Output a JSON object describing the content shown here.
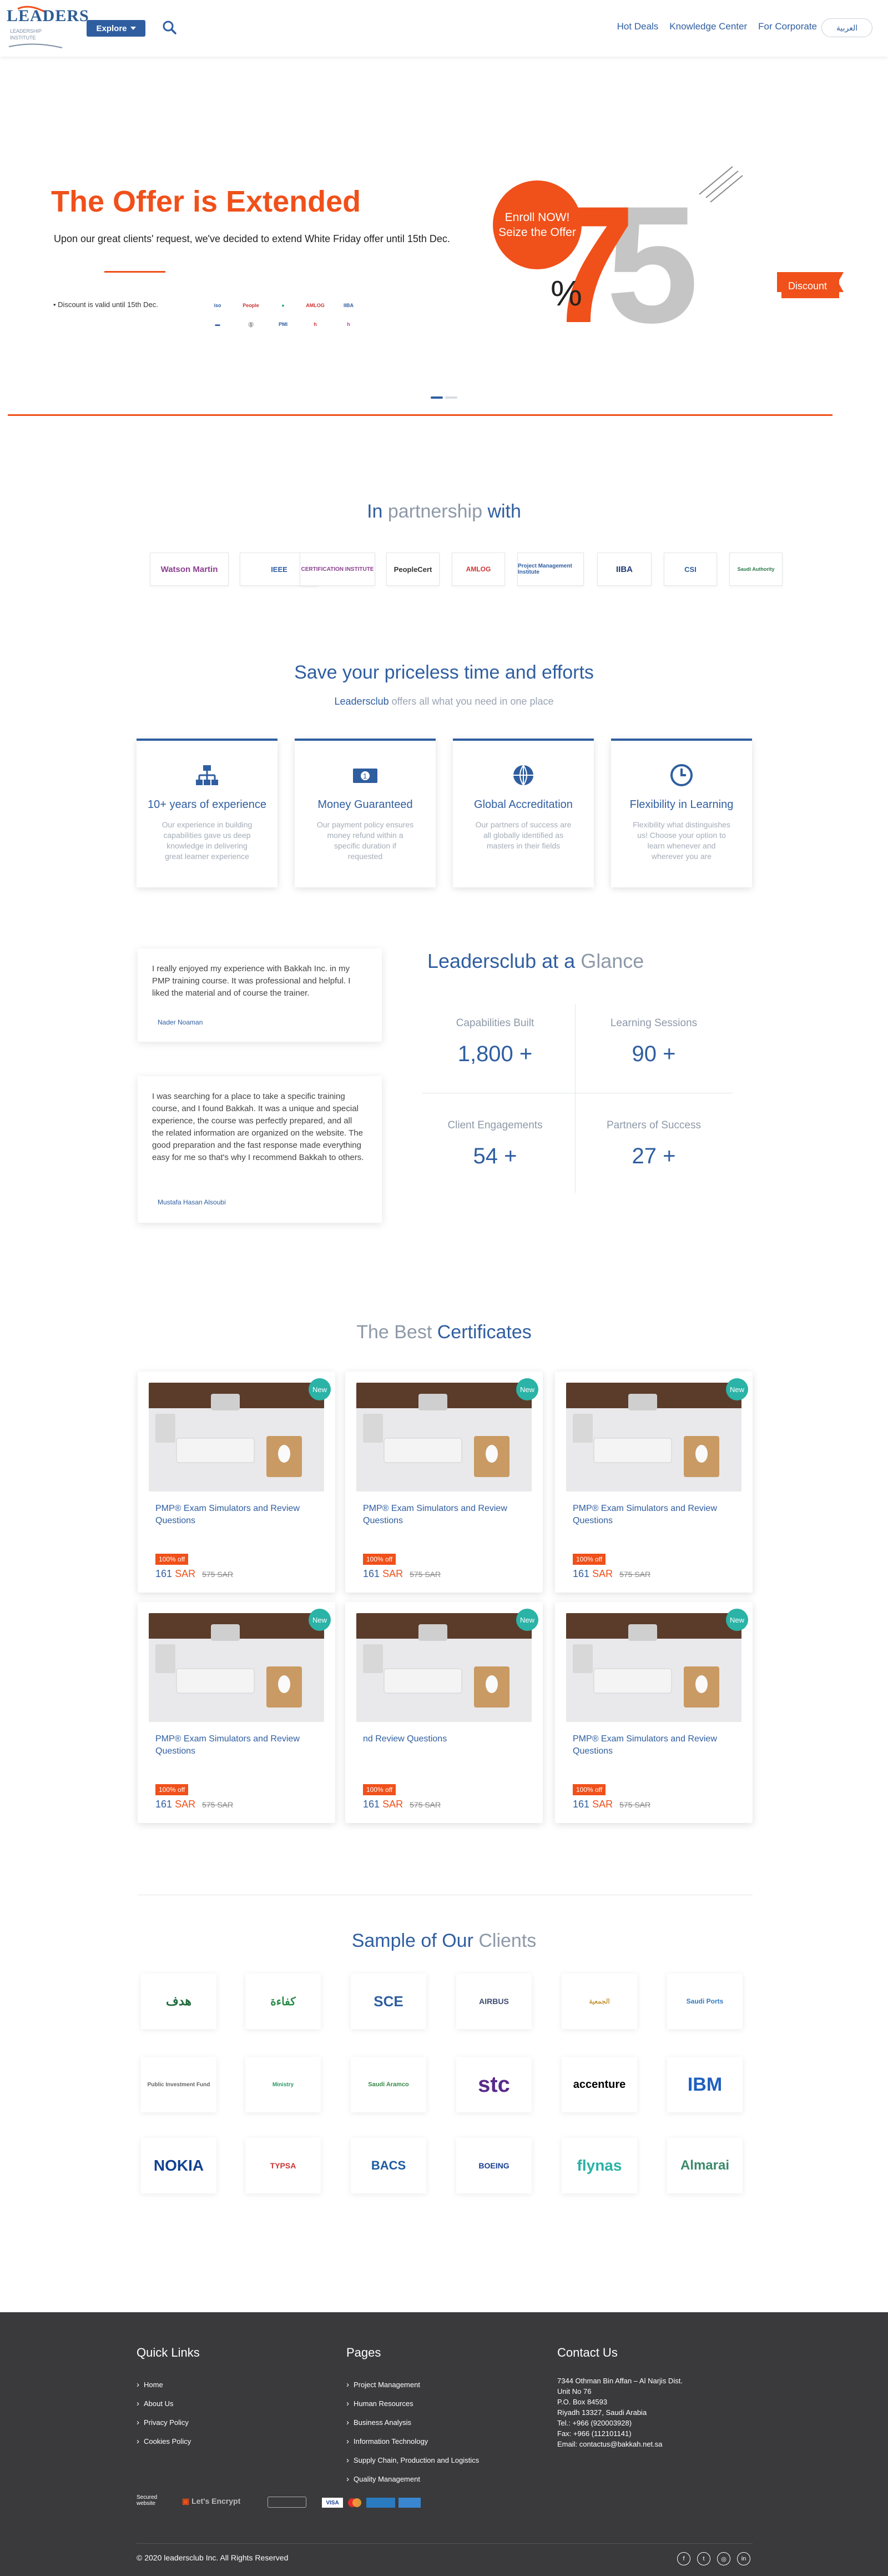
{
  "header": {
    "logo_text": "LEADERS",
    "logo_sub": "LEADERSHIP INSTITUTE",
    "explore_label": "Explore",
    "nav": [
      "Hot Deals",
      "Knowledge Center",
      "For Corporate"
    ],
    "lang_label": "العربية"
  },
  "hero": {
    "title": "The Offer is Extended",
    "text": "Upon our great clients' request, we've decided to extend White Friday offer until 15th Dec.",
    "bullet": "Discount is valid until 15th Dec.",
    "enroll_line1": "Enroll NOW!",
    "enroll_line2": "Seize the Offer",
    "percent_sign": "%",
    "big_number": "75",
    "discount_label": "Discount"
  },
  "partnership": {
    "title_a": "In",
    "title_b": "partnership",
    "title_c": "with",
    "logos": [
      "Watson Martin",
      "IEEE",
      "CERTIFICATION INSTITUTE",
      "PeopleCert",
      "AMLOG",
      "Project Management Institute",
      "IIBA",
      "CSI",
      "Saudi Authority"
    ]
  },
  "save": {
    "title": "Save your priceless time and efforts",
    "sub_brand": "Leadersclub",
    "sub_rest": "offers all what you need in one place",
    "features": [
      {
        "title": "10+ years of experience",
        "text": "Our experience in building capabilities gave us deep knowledge in delivering great learner experience"
      },
      {
        "title": "Money Guaranteed",
        "text": "Our payment policy ensures money refund within a specific duration if requested"
      },
      {
        "title": "Global Accreditation",
        "text": "Our partners of success are all globally identified as masters in their fields"
      },
      {
        "title": "Flexibility in Learning",
        "text": "Flexibility what distinguishes us! Choose your option to learn whenever and wherever you are"
      }
    ]
  },
  "testimonials": [
    {
      "text": "I really enjoyed my experience with Bakkah Inc. in my PMP training course. It was professional and helpful. I liked the material and of course the trainer.",
      "author": "Nader Noaman"
    },
    {
      "text": "I was searching for a place to take a specific training course, and I found Bakkah. It was a unique and special experience, the course was perfectly prepared, and all the related information are organized on the website. The good preparation and the fast response made everything easy for me so that's why I recommend Bakkah to others.",
      "author": "Mustafa Hasan Alsoubi"
    }
  ],
  "glance": {
    "title_a": "Leadersclub at a",
    "title_b": "Glance",
    "stats": [
      {
        "label": "Capabilities Built",
        "value": "1,800 +"
      },
      {
        "label": "Learning Sessions",
        "value": "90 +"
      },
      {
        "label": "Client Engagements",
        "value": "54 +"
      },
      {
        "label": "Partners of Success",
        "value": "27 +"
      }
    ]
  },
  "certificates": {
    "title_a": "The Best",
    "title_b": "Certificates",
    "items": [
      {
        "new": "New",
        "title": "PMP® Exam Simulators and Review Questions",
        "badge": "100% off",
        "price": "161",
        "currency": "SAR",
        "old": "575 SAR"
      },
      {
        "new": "New",
        "title": "PMP® Exam Simulators and Review Questions",
        "badge": "100% off",
        "price": "161",
        "currency": "SAR",
        "old": "575 SAR"
      },
      {
        "new": "New",
        "title": "PMP® Exam Simulators and Review Questions",
        "badge": "100% off",
        "price": "161",
        "currency": "SAR",
        "old": "575 SAR"
      },
      {
        "new": "New",
        "title": "PMP® Exam Simulators and Review Questions",
        "badge": "100% off",
        "price": "161",
        "currency": "SAR",
        "old": "575 SAR"
      },
      {
        "new": "New",
        "title": "nd Review Questions",
        "badge": "100% off",
        "price": "161",
        "currency": "SAR",
        "old": "575 SAR"
      },
      {
        "new": "New",
        "title": "PMP® Exam Simulators and Review Questions",
        "badge": "100% off",
        "price": "161",
        "currency": "SAR",
        "old": "575 SAR"
      }
    ]
  },
  "clients": {
    "title_a": "Sample of Our",
    "title_b": "Clients",
    "logos": [
      "هدف",
      "كفاءة",
      "SCE",
      "AIRBUS",
      "الجمعية",
      "Saudi Ports",
      "Public Investment Fund",
      "Ministry",
      "Saudi Aramco",
      "stc",
      "accenture",
      "IBM",
      "NOKIA",
      "TYPSA",
      "BACS",
      "BOEING",
      "flynas",
      "Almarai"
    ]
  },
  "footer": {
    "quick_links_title": "Quick Links",
    "quick_links": [
      "Home",
      "About Us",
      "Privacy Policy",
      "Cookies Policy"
    ],
    "pages_title": "Pages",
    "pages": [
      "Project Management",
      "Human Resources",
      "Business Analysis",
      "Information Technology",
      "Supply Chain, Production and Logistics",
      "Quality Management"
    ],
    "contact_title": "Contact Us",
    "contact_lines": [
      "7344 Othman Bin Affan – Al Narjis Dist.",
      "Unit No 76",
      "P.O. Box 84593",
      "Riyadh 13327, Saudi Arabia",
      "Tel.: +966 (920003928)",
      "Fax: +966 (112101141)",
      "Email: contactus@bakkah.net.sa"
    ],
    "secured": "Secured website",
    "encrypt": "Let's Encrypt",
    "copyright": "© 2020 leadersclub Inc. All Rights Reserved"
  },
  "colors": {
    "brand_blue": "#2f5ea0",
    "accent_orange": "#f0501a",
    "teal": "#2ab3a6",
    "footer_bg": "#3a3a3c"
  }
}
